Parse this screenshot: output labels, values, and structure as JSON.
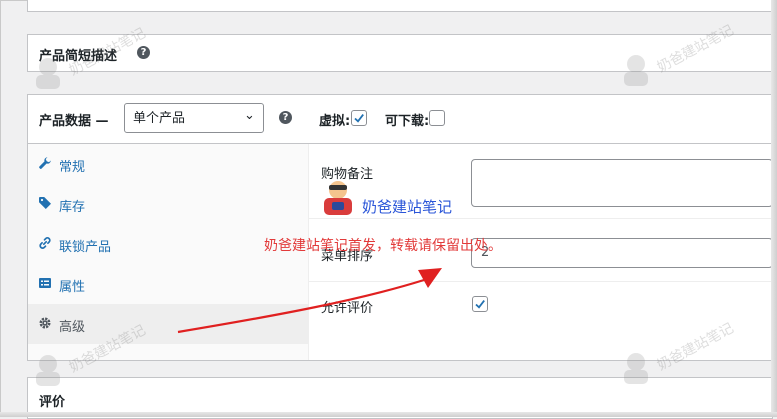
{
  "excerpt": {
    "title": "产品简短描述"
  },
  "product_data": {
    "label": "产品数据 —",
    "type_select": {
      "value": "单个产品",
      "options": [
        "单个产品"
      ]
    },
    "virtual_label": "虚拟:",
    "virtual_checked": true,
    "downloadable_label": "可下载:",
    "downloadable_checked": false,
    "tabs": [
      {
        "label": "常规",
        "icon": "wrench-icon"
      },
      {
        "label": "库存",
        "icon": "tag-icon"
      },
      {
        "label": "联锁产品",
        "icon": "link-icon"
      },
      {
        "label": "属性",
        "icon": "list-icon"
      },
      {
        "label": "高级",
        "icon": "gear-icon",
        "active": true
      }
    ],
    "panel": {
      "purchase_note_label": "购物备注",
      "purchase_note_value": "",
      "menu_order_label": "菜单排序",
      "menu_order_value": "2",
      "enable_reviews_label": "允许评价",
      "enable_reviews_checked": true
    }
  },
  "reviews": {
    "title": "评价"
  },
  "overlay": {
    "logo_text": "奶爸建站笔记",
    "notice": "奶爸建站笔记首发，转载请保留出处。",
    "watermark_text": "奶爸建站笔记"
  },
  "colors": {
    "link": "#2271b1",
    "checkbox": "#2271b1",
    "arrow": "#e02020",
    "notice": "#e23a3a",
    "logo_text": "#2a55d8"
  }
}
